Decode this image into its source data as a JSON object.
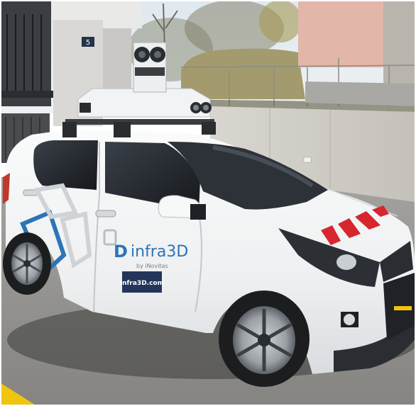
{
  "photo": {
    "building_sign": "5",
    "car_branding": {
      "logo_letter": "D",
      "brand_name": "infra3D",
      "tagline": "by iNovitas",
      "website": "infra3D.com"
    }
  },
  "colors": {
    "car_body": "#f4f5f6",
    "brand_blue": "#2c74b6",
    "website_badge": "#23365a",
    "hood_stripe_red": "#d8262e",
    "asphalt": "#8f8f8d",
    "retaining_wall": "#cfcbc4",
    "road_marking_yellow": "#f1c40f"
  }
}
